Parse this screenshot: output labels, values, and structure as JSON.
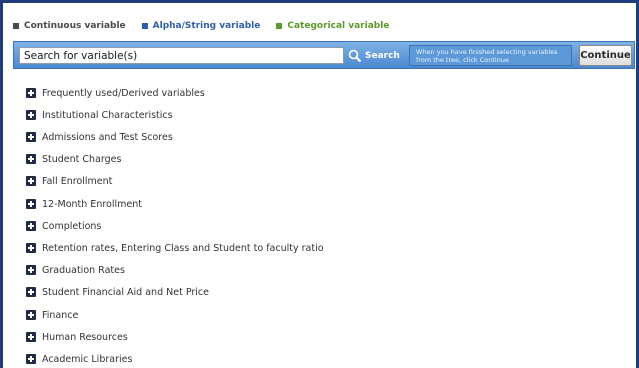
{
  "legend": {
    "items": [
      {
        "label": "Continuous variable",
        "color": "#4a4a4a"
      },
      {
        "label": "Alpha/String variable",
        "color": "#2e5fa8"
      },
      {
        "label": "Categorical variable",
        "color": "#5a9a2c"
      }
    ]
  },
  "toolbar": {
    "search_value": "Search for variable(s)",
    "search_button_label": "Search",
    "hint_text": "When you have finished selecting variables from the tree, click Continue",
    "continue_label": "Continue"
  },
  "tree": {
    "items": [
      "Frequently used/Derived variables",
      "Institutional Characteristics",
      "Admissions and Test Scores",
      "Student Charges",
      "Fall Enrollment",
      "12-Month Enrollment",
      "Completions",
      "Retention rates, Entering Class and Student to faculty ratio",
      "Graduation Rates",
      "Student Financial Aid and Net Price",
      "Finance",
      "Human Resources",
      "Academic Libraries"
    ]
  },
  "colors": {
    "frame_border": "#1f3d7a",
    "toolbar_bar": "#4a88cf",
    "expand_icon": "#1f2a44"
  }
}
